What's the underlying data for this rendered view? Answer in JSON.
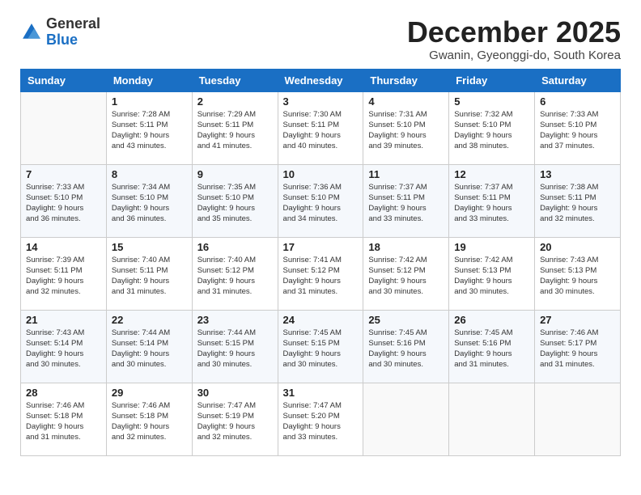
{
  "logo": {
    "line1": "General",
    "line2": "Blue"
  },
  "title": "December 2025",
  "location": "Gwanin, Gyeonggi-do, South Korea",
  "weekdays": [
    "Sunday",
    "Monday",
    "Tuesday",
    "Wednesday",
    "Thursday",
    "Friday",
    "Saturday"
  ],
  "weeks": [
    [
      {
        "day": "",
        "info": ""
      },
      {
        "day": "1",
        "info": "Sunrise: 7:28 AM\nSunset: 5:11 PM\nDaylight: 9 hours\nand 43 minutes."
      },
      {
        "day": "2",
        "info": "Sunrise: 7:29 AM\nSunset: 5:11 PM\nDaylight: 9 hours\nand 41 minutes."
      },
      {
        "day": "3",
        "info": "Sunrise: 7:30 AM\nSunset: 5:11 PM\nDaylight: 9 hours\nand 40 minutes."
      },
      {
        "day": "4",
        "info": "Sunrise: 7:31 AM\nSunset: 5:10 PM\nDaylight: 9 hours\nand 39 minutes."
      },
      {
        "day": "5",
        "info": "Sunrise: 7:32 AM\nSunset: 5:10 PM\nDaylight: 9 hours\nand 38 minutes."
      },
      {
        "day": "6",
        "info": "Sunrise: 7:33 AM\nSunset: 5:10 PM\nDaylight: 9 hours\nand 37 minutes."
      }
    ],
    [
      {
        "day": "7",
        "info": "Sunrise: 7:33 AM\nSunset: 5:10 PM\nDaylight: 9 hours\nand 36 minutes."
      },
      {
        "day": "8",
        "info": "Sunrise: 7:34 AM\nSunset: 5:10 PM\nDaylight: 9 hours\nand 36 minutes."
      },
      {
        "day": "9",
        "info": "Sunrise: 7:35 AM\nSunset: 5:10 PM\nDaylight: 9 hours\nand 35 minutes."
      },
      {
        "day": "10",
        "info": "Sunrise: 7:36 AM\nSunset: 5:10 PM\nDaylight: 9 hours\nand 34 minutes."
      },
      {
        "day": "11",
        "info": "Sunrise: 7:37 AM\nSunset: 5:11 PM\nDaylight: 9 hours\nand 33 minutes."
      },
      {
        "day": "12",
        "info": "Sunrise: 7:37 AM\nSunset: 5:11 PM\nDaylight: 9 hours\nand 33 minutes."
      },
      {
        "day": "13",
        "info": "Sunrise: 7:38 AM\nSunset: 5:11 PM\nDaylight: 9 hours\nand 32 minutes."
      }
    ],
    [
      {
        "day": "14",
        "info": "Sunrise: 7:39 AM\nSunset: 5:11 PM\nDaylight: 9 hours\nand 32 minutes."
      },
      {
        "day": "15",
        "info": "Sunrise: 7:40 AM\nSunset: 5:11 PM\nDaylight: 9 hours\nand 31 minutes."
      },
      {
        "day": "16",
        "info": "Sunrise: 7:40 AM\nSunset: 5:12 PM\nDaylight: 9 hours\nand 31 minutes."
      },
      {
        "day": "17",
        "info": "Sunrise: 7:41 AM\nSunset: 5:12 PM\nDaylight: 9 hours\nand 31 minutes."
      },
      {
        "day": "18",
        "info": "Sunrise: 7:42 AM\nSunset: 5:12 PM\nDaylight: 9 hours\nand 30 minutes."
      },
      {
        "day": "19",
        "info": "Sunrise: 7:42 AM\nSunset: 5:13 PM\nDaylight: 9 hours\nand 30 minutes."
      },
      {
        "day": "20",
        "info": "Sunrise: 7:43 AM\nSunset: 5:13 PM\nDaylight: 9 hours\nand 30 minutes."
      }
    ],
    [
      {
        "day": "21",
        "info": "Sunrise: 7:43 AM\nSunset: 5:14 PM\nDaylight: 9 hours\nand 30 minutes."
      },
      {
        "day": "22",
        "info": "Sunrise: 7:44 AM\nSunset: 5:14 PM\nDaylight: 9 hours\nand 30 minutes."
      },
      {
        "day": "23",
        "info": "Sunrise: 7:44 AM\nSunset: 5:15 PM\nDaylight: 9 hours\nand 30 minutes."
      },
      {
        "day": "24",
        "info": "Sunrise: 7:45 AM\nSunset: 5:15 PM\nDaylight: 9 hours\nand 30 minutes."
      },
      {
        "day": "25",
        "info": "Sunrise: 7:45 AM\nSunset: 5:16 PM\nDaylight: 9 hours\nand 30 minutes."
      },
      {
        "day": "26",
        "info": "Sunrise: 7:45 AM\nSunset: 5:16 PM\nDaylight: 9 hours\nand 31 minutes."
      },
      {
        "day": "27",
        "info": "Sunrise: 7:46 AM\nSunset: 5:17 PM\nDaylight: 9 hours\nand 31 minutes."
      }
    ],
    [
      {
        "day": "28",
        "info": "Sunrise: 7:46 AM\nSunset: 5:18 PM\nDaylight: 9 hours\nand 31 minutes."
      },
      {
        "day": "29",
        "info": "Sunrise: 7:46 AM\nSunset: 5:18 PM\nDaylight: 9 hours\nand 32 minutes."
      },
      {
        "day": "30",
        "info": "Sunrise: 7:47 AM\nSunset: 5:19 PM\nDaylight: 9 hours\nand 32 minutes."
      },
      {
        "day": "31",
        "info": "Sunrise: 7:47 AM\nSunset: 5:20 PM\nDaylight: 9 hours\nand 33 minutes."
      },
      {
        "day": "",
        "info": ""
      },
      {
        "day": "",
        "info": ""
      },
      {
        "day": "",
        "info": ""
      }
    ]
  ]
}
